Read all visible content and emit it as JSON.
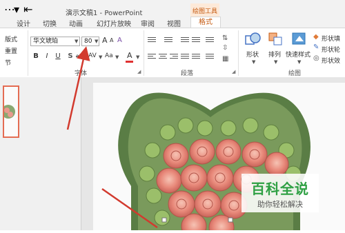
{
  "app": {
    "title": "演示文稿1 - PowerPoint",
    "tool_context": "绘图工具",
    "quick_access": [
      "⋯",
      "▾",
      "⇤"
    ]
  },
  "tabs": [
    "设计",
    "切换",
    "动画",
    "幻灯片放映",
    "审阅",
    "视图",
    "格式"
  ],
  "ribbon": {
    "left_group": {
      "items": [
        "版式",
        "重置",
        "节"
      ]
    },
    "font_group": {
      "label": "字体",
      "font_name": "华文琥珀",
      "font_size": "80",
      "grow": "A",
      "shrink": "A",
      "clear_format": "A",
      "bold": "B",
      "italic": "I",
      "underline": "U",
      "shadow": "S",
      "strike": "abc",
      "spacing": "AV",
      "change_case": "Aa",
      "font_color": "A",
      "font_color_hex": "#e03030"
    },
    "paragraph_group": {
      "label": "段落"
    },
    "drawing_group": {
      "label": "绘图",
      "shapes": "形状",
      "arrange": "排列",
      "quick_styles": "快速样式",
      "shape_fill": "形状填",
      "shape_outline": "形状轮",
      "shape_effects": "形状效"
    }
  },
  "watermark": {
    "main": "百科全说",
    "sub": "助你轻松解决"
  },
  "colors": {
    "accent": "#c55a11",
    "thumb_border": "#e46c52",
    "arrow": "#d23a2e",
    "watermark_green": "#2ea043"
  }
}
